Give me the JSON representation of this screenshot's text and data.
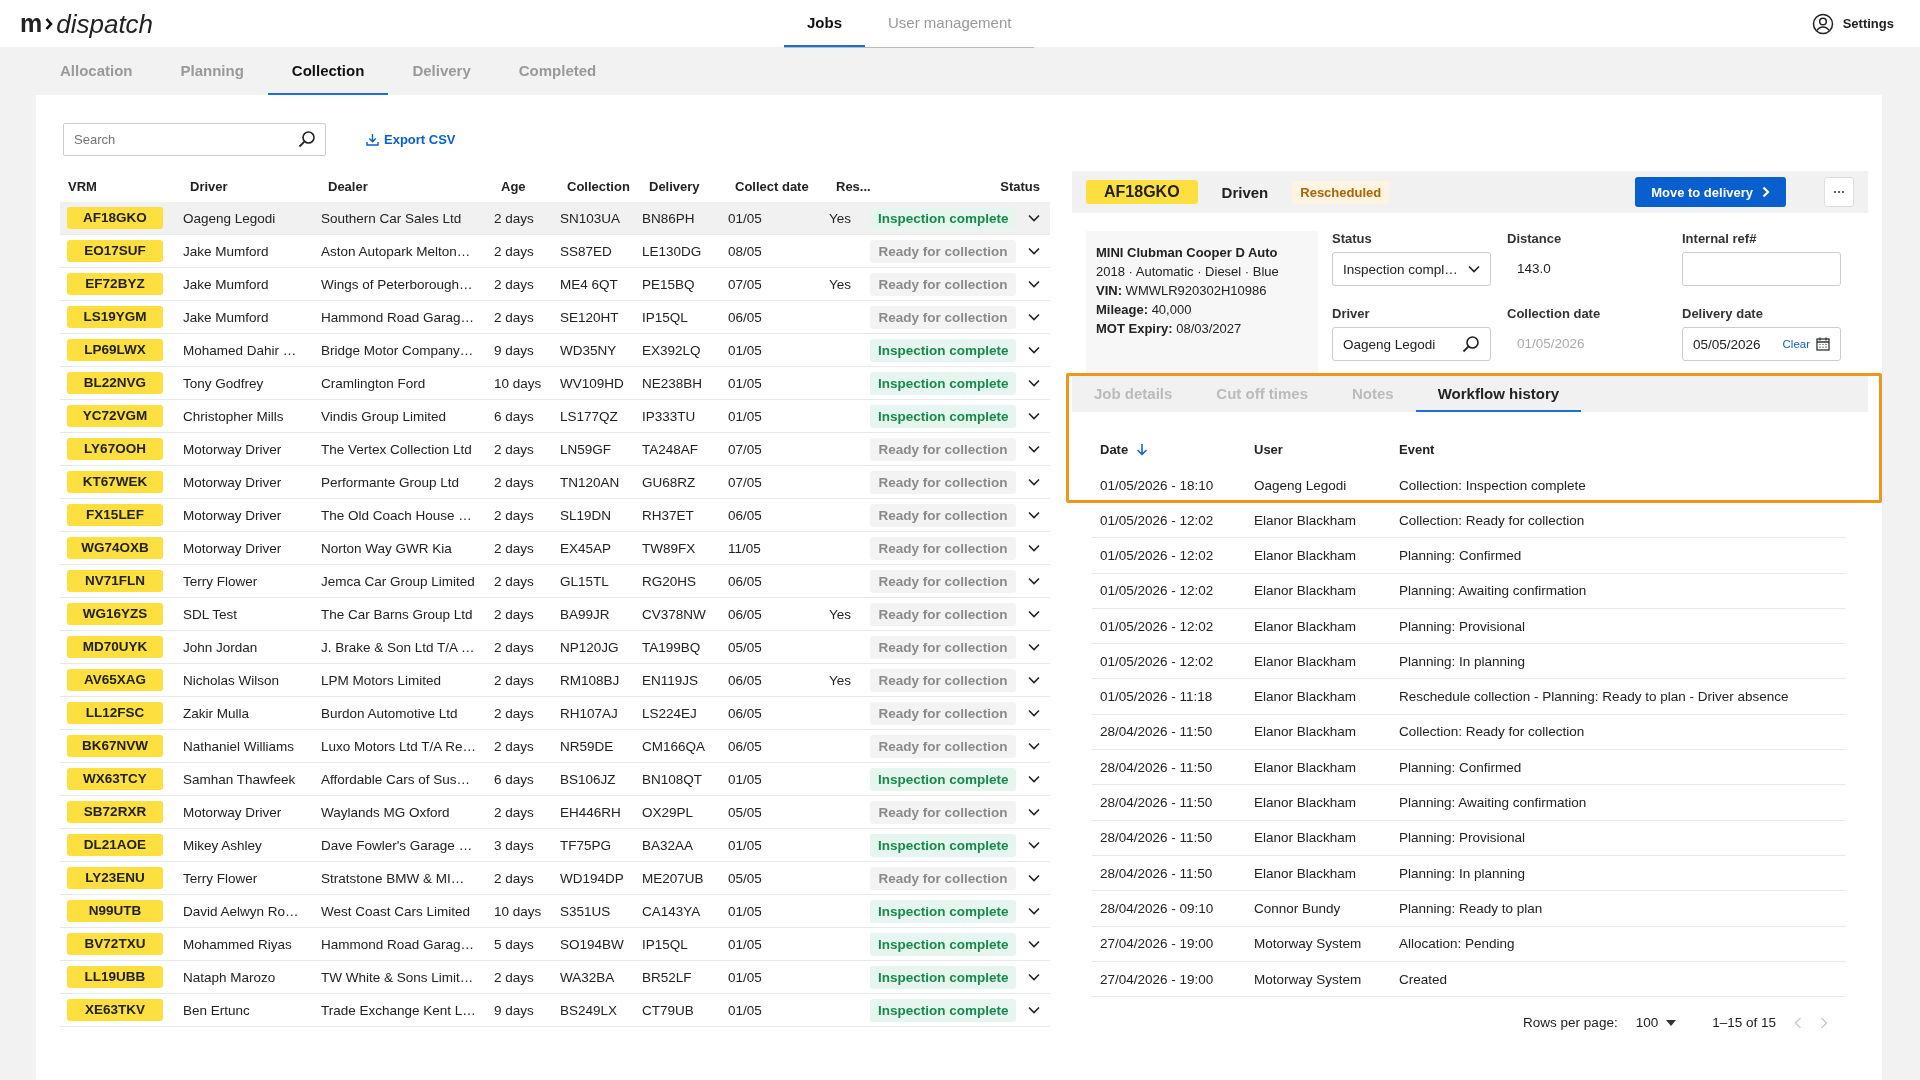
{
  "logo": {
    "mark": "m",
    "name": "dispatch"
  },
  "nav": [
    {
      "label": "Jobs",
      "selected": true
    },
    {
      "label": "User management",
      "selected": false
    }
  ],
  "settings": "Settings",
  "subtabs": [
    {
      "label": "Allocation",
      "selected": false
    },
    {
      "label": "Planning",
      "selected": false
    },
    {
      "label": "Collection",
      "selected": true
    },
    {
      "label": "Delivery",
      "selected": false
    },
    {
      "label": "Completed",
      "selected": false
    }
  ],
  "search": {
    "placeholder": "Search"
  },
  "export": "Export CSV",
  "jobs": {
    "columns": [
      "VRM",
      "Driver",
      "Dealer",
      "Age",
      "Collection",
      "Delivery",
      "Collect date",
      "Res...",
      "Status"
    ],
    "rows": [
      {
        "vrm": "AF18GKO",
        "driver": "Oageng Legodi",
        "dealer": "Southern Car Sales Ltd",
        "age": "2 days",
        "collection": "SN103UA",
        "delivery": "BN86PH",
        "collect_date": "01/05",
        "res": "Yes",
        "status": "Inspection complete",
        "kind": "complete",
        "selected": true
      },
      {
        "vrm": "EO17SUF",
        "driver": "Jake Mumford",
        "dealer": "Aston Autopark Melton…",
        "age": "2 days",
        "collection": "SS87ED",
        "delivery": "LE130DG",
        "collect_date": "08/05",
        "status": "Ready for collection",
        "kind": "ready",
        "selected": false
      },
      {
        "vrm": "EF72BYZ",
        "driver": "Jake Mumford",
        "dealer": "Wings of Peterborough…",
        "age": "2 days",
        "collection": "ME4 6QT",
        "delivery": "PE15BQ",
        "collect_date": "07/05",
        "res": "Yes",
        "status": "Ready for collection",
        "kind": "ready",
        "selected": false
      },
      {
        "vrm": "LS19YGM",
        "driver": "Jake Mumford",
        "dealer": "Hammond Road Garag…",
        "age": "2 days",
        "collection": "SE120HT",
        "delivery": "IP15QL",
        "collect_date": "06/05",
        "status": "Ready for collection",
        "kind": "ready",
        "selected": false
      },
      {
        "vrm": "LP69LWX",
        "driver": "Mohamed Dahir …",
        "dealer": "Bridge Motor Company…",
        "age": "9 days",
        "collection": "WD35NY",
        "delivery": "EX392LQ",
        "collect_date": "01/05",
        "status": "Inspection complete",
        "kind": "complete",
        "selected": false
      },
      {
        "vrm": "BL22NVG",
        "driver": "Tony Godfrey",
        "dealer": "Cramlington Ford",
        "age": "10 days",
        "collection": "WV109HD",
        "delivery": "NE238BH",
        "collect_date": "01/05",
        "status": "Inspection complete",
        "kind": "complete",
        "selected": false
      },
      {
        "vrm": "YC72VGM",
        "driver": "Christopher Mills",
        "dealer": "Vindis Group Limited",
        "age": "6 days",
        "collection": "LS177QZ",
        "delivery": "IP333TU",
        "collect_date": "01/05",
        "status": "Inspection complete",
        "kind": "complete",
        "selected": false
      },
      {
        "vrm": "LY67OOH",
        "driver": "Motorway Driver",
        "dealer": "The Vertex Collection Ltd",
        "age": "2 days",
        "collection": "LN59GF",
        "delivery": "TA248AF",
        "collect_date": "07/05",
        "status": "Ready for collection",
        "kind": "ready",
        "selected": false
      },
      {
        "vrm": "KT67WEK",
        "driver": "Motorway Driver",
        "dealer": "Performante Group Ltd",
        "age": "2 days",
        "collection": "TN120AN",
        "delivery": "GU68RZ",
        "collect_date": "07/05",
        "status": "Ready for collection",
        "kind": "ready",
        "selected": false
      },
      {
        "vrm": "FX15LEF",
        "driver": "Motorway Driver",
        "dealer": "The Old Coach House …",
        "age": "2 days",
        "collection": "SL19DN",
        "delivery": "RH37ET",
        "collect_date": "06/05",
        "status": "Ready for collection",
        "kind": "ready",
        "selected": false
      },
      {
        "vrm": "WG74OXB",
        "driver": "Motorway Driver",
        "dealer": "Norton Way GWR Kia",
        "age": "2 days",
        "collection": "EX45AP",
        "delivery": "TW89FX",
        "collect_date": "11/05",
        "status": "Ready for collection",
        "kind": "ready",
        "selected": false
      },
      {
        "vrm": "NV71FLN",
        "driver": "Terry Flower",
        "dealer": "Jemca Car Group Limited",
        "age": "2 days",
        "collection": "GL15TL",
        "delivery": "RG20HS",
        "collect_date": "06/05",
        "status": "Ready for collection",
        "kind": "ready",
        "selected": false
      },
      {
        "vrm": "WG16YZS",
        "driver": "SDL Test",
        "dealer": "The Car Barns Group Ltd",
        "age": "2 days",
        "collection": "BA99JR",
        "delivery": "CV378NW",
        "collect_date": "06/05",
        "res": "Yes",
        "status": "Ready for collection",
        "kind": "ready",
        "selected": false
      },
      {
        "vrm": "MD70UYK",
        "driver": "John Jordan",
        "dealer": "J. Brake & Son Ltd T/A …",
        "age": "2 days",
        "collection": "NP120JG",
        "delivery": "TA199BQ",
        "collect_date": "05/05",
        "status": "Ready for collection",
        "kind": "ready",
        "selected": false
      },
      {
        "vrm": "AV65XAG",
        "driver": "Nicholas Wilson",
        "dealer": "LPM Motors Limited",
        "age": "2 days",
        "collection": "RM108BJ",
        "delivery": "EN119JS",
        "collect_date": "06/05",
        "res": "Yes",
        "status": "Ready for collection",
        "kind": "ready",
        "selected": false
      },
      {
        "vrm": "LL12FSC",
        "driver": "Zakir Mulla",
        "dealer": "Burdon Automotive Ltd",
        "age": "2 days",
        "collection": "RH107AJ",
        "delivery": "LS224EJ",
        "collect_date": "06/05",
        "status": "Ready for collection",
        "kind": "ready",
        "selected": false
      },
      {
        "vrm": "BK67NVW",
        "driver": "Nathaniel Williams",
        "dealer": "Luxo Motors Ltd T/A Re…",
        "age": "2 days",
        "collection": "NR59DE",
        "delivery": "CM166QA",
        "collect_date": "06/05",
        "status": "Ready for collection",
        "kind": "ready",
        "selected": false
      },
      {
        "vrm": "WX63TCY",
        "driver": "Samhan Thawfeek",
        "dealer": "Affordable Cars of Sus…",
        "age": "6 days",
        "collection": "BS106JZ",
        "delivery": "BN108QT",
        "collect_date": "01/05",
        "status": "Inspection complete",
        "kind": "complete",
        "selected": false
      },
      {
        "vrm": "SB72RXR",
        "driver": "Motorway Driver",
        "dealer": "Waylands MG Oxford",
        "age": "2 days",
        "collection": "EH446RH",
        "delivery": "OX29PL",
        "collect_date": "05/05",
        "status": "Ready for collection",
        "kind": "ready",
        "selected": false
      },
      {
        "vrm": "DL21AOE",
        "driver": "Mikey Ashley",
        "dealer": "Dave Fowler's Garage …",
        "age": "3 days",
        "collection": "TF75PG",
        "delivery": "BA32AA",
        "collect_date": "01/05",
        "status": "Inspection complete",
        "kind": "complete",
        "selected": false
      },
      {
        "vrm": "LY23ENU",
        "driver": "Terry Flower",
        "dealer": "Stratstone BMW & MI…",
        "age": "2 days",
        "collection": "WD194DP",
        "delivery": "ME207UB",
        "collect_date": "05/05",
        "status": "Ready for collection",
        "kind": "ready",
        "selected": false
      },
      {
        "vrm": "N99UTB",
        "driver": "David Aelwyn Ro…",
        "dealer": "West Coast Cars Limited",
        "age": "10 days",
        "collection": "S351US",
        "delivery": "CA143YA",
        "collect_date": "01/05",
        "status": "Inspection complete",
        "kind": "complete",
        "selected": false
      },
      {
        "vrm": "BV72TXU",
        "driver": "Mohammed Riyas",
        "dealer": "Hammond Road Garag…",
        "age": "5 days",
        "collection": "SO194BW",
        "delivery": "IP15QL",
        "collect_date": "01/05",
        "status": "Inspection complete",
        "kind": "complete",
        "selected": false
      },
      {
        "vrm": "LL19UBB",
        "driver": "Nataph Marozo",
        "dealer": "TW White & Sons Limit…",
        "age": "2 days",
        "collection": "WA32BA",
        "delivery": "BR52LF",
        "collect_date": "01/05",
        "status": "Inspection complete",
        "kind": "complete",
        "selected": false
      },
      {
        "vrm": "XE63TKV",
        "driver": "Ben Ertunc",
        "dealer": "Trade Exchange Kent L…",
        "age": "9 days",
        "collection": "BS249LX",
        "delivery": "CT79UB",
        "collect_date": "01/05",
        "status": "Inspection complete",
        "kind": "complete",
        "selected": false
      }
    ]
  },
  "detail": {
    "vrm": "AF18GKO",
    "mode": "Driven",
    "badge": "Rescheduled",
    "action": "Move to delivery",
    "vehicle": {
      "title": "MINI Clubman Cooper D Auto",
      "lines": [
        "2018 · Automatic · Diesel · Blue",
        "**VIN:** WMWLR920302H10986",
        "**Mileage:** 40,000",
        "**MOT Expiry:** 08/03/2027"
      ]
    },
    "fields": [
      {
        "label": "Status",
        "kind": "select",
        "value": "Inspection compl…"
      },
      {
        "label": "Distance",
        "kind": "text",
        "value": "143.0"
      },
      {
        "label": "Internal ref#",
        "kind": "input"
      },
      {
        "label": "Driver",
        "kind": "search",
        "value": "Oageng Legodi"
      },
      {
        "label": "Collection date",
        "kind": "disabled",
        "value": "01/05/2026"
      },
      {
        "label": "Delivery date",
        "kind": "date",
        "value": "05/05/2026",
        "action": "Clear"
      }
    ]
  },
  "history": {
    "tabs": [
      {
        "label": "Job details",
        "selected": false
      },
      {
        "label": "Cut off times",
        "selected": false
      },
      {
        "label": "Notes",
        "selected": false
      },
      {
        "label": "Workflow history",
        "selected": true
      }
    ],
    "columns": [
      "Date",
      "User",
      "Event"
    ],
    "rows": [
      {
        "date": "01/05/2026 - 18:10",
        "user": "Oageng Legodi",
        "event": "Collection: Inspection complete"
      },
      {
        "date": "01/05/2026 - 12:02",
        "user": "Elanor Blackham",
        "event": "Collection: Ready for collection"
      },
      {
        "date": "01/05/2026 - 12:02",
        "user": "Elanor Blackham",
        "event": "Planning: Confirmed"
      },
      {
        "date": "01/05/2026 - 12:02",
        "user": "Elanor Blackham",
        "event": "Planning: Awaiting confirmation"
      },
      {
        "date": "01/05/2026 - 12:02",
        "user": "Elanor Blackham",
        "event": "Planning: Provisional"
      },
      {
        "date": "01/05/2026 - 12:02",
        "user": "Elanor Blackham",
        "event": "Planning: In planning"
      },
      {
        "date": "01/05/2026 - 11:18",
        "user": "Elanor Blackham",
        "event": "Reschedule collection - Planning: Ready to plan - Driver absence"
      },
      {
        "date": "28/04/2026 - 11:50",
        "user": "Elanor Blackham",
        "event": "Collection: Ready for collection"
      },
      {
        "date": "28/04/2026 - 11:50",
        "user": "Elanor Blackham",
        "event": "Planning: Confirmed"
      },
      {
        "date": "28/04/2026 - 11:50",
        "user": "Elanor Blackham",
        "event": "Planning: Awaiting confirmation"
      },
      {
        "date": "28/04/2026 - 11:50",
        "user": "Elanor Blackham",
        "event": "Planning: Provisional"
      },
      {
        "date": "28/04/2026 - 11:50",
        "user": "Elanor Blackham",
        "event": "Planning: In planning"
      },
      {
        "date": "28/04/2026 - 09:10",
        "user": "Connor Bundy",
        "event": "Planning: Ready to plan"
      },
      {
        "date": "27/04/2026 - 19:00",
        "user": "Motorway System",
        "event": "Allocation: Pending"
      },
      {
        "date": "27/04/2026 - 19:00",
        "user": "Motorway System",
        "event": "Created"
      }
    ],
    "rows_per_page_label": "Rows per page:",
    "rows_per_page": "100",
    "range": "1–15 of 15"
  }
}
